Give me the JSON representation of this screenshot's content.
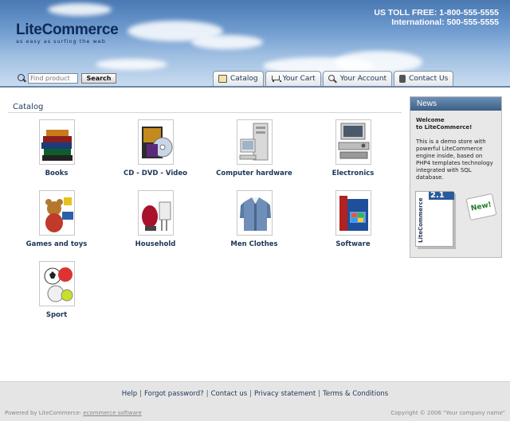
{
  "header": {
    "logo_text": "LiteCommerce",
    "logo_tagline": "as easy as surfing the web",
    "phone_tollfree": "US TOLL FREE: 1-800-555-5555",
    "phone_international": "International: 500-555-5555"
  },
  "search": {
    "placeholder": "Find product",
    "button_label": "Search"
  },
  "tabs": [
    {
      "label": "Catalog",
      "icon": "folder-icon"
    },
    {
      "label": "Your Cart",
      "icon": "cart-icon"
    },
    {
      "label": "Your Account",
      "icon": "magnifier-icon"
    },
    {
      "label": "Contact Us",
      "icon": "phone-icon"
    }
  ],
  "catalog": {
    "title": "Catalog",
    "categories": [
      {
        "label": "Books"
      },
      {
        "label": "CD - DVD - Video"
      },
      {
        "label": "Computer hardware"
      },
      {
        "label": "Electronics"
      },
      {
        "label": "Games and toys"
      },
      {
        "label": "Household"
      },
      {
        "label": "Men Clothes"
      },
      {
        "label": "Software"
      },
      {
        "label": "Sport"
      }
    ]
  },
  "news": {
    "title": "News",
    "welcome_line1": "Welcome",
    "welcome_line2": "to LiteCommerce!",
    "body": "This is a demo store with powerful LiteCommerce engine inside, based on PHP4 templates technology integrated with SQL database.",
    "box_version": "2.1",
    "box_name": "LiteCommerce",
    "new_tag": "New!"
  },
  "footer": {
    "links": [
      "Help",
      "Forgot password?",
      "Contact us",
      "Privacy statement",
      "Terms & Conditions"
    ],
    "powered_prefix": "Powered by LiteCommerce:",
    "powered_link": "ecommerce software",
    "copyright": "Copyright © 2006 \"Your company name\""
  },
  "colors": {
    "brand_dark": "#1d3557",
    "header_sky": "#6f9bcf",
    "news_header": "#3c5f86"
  }
}
